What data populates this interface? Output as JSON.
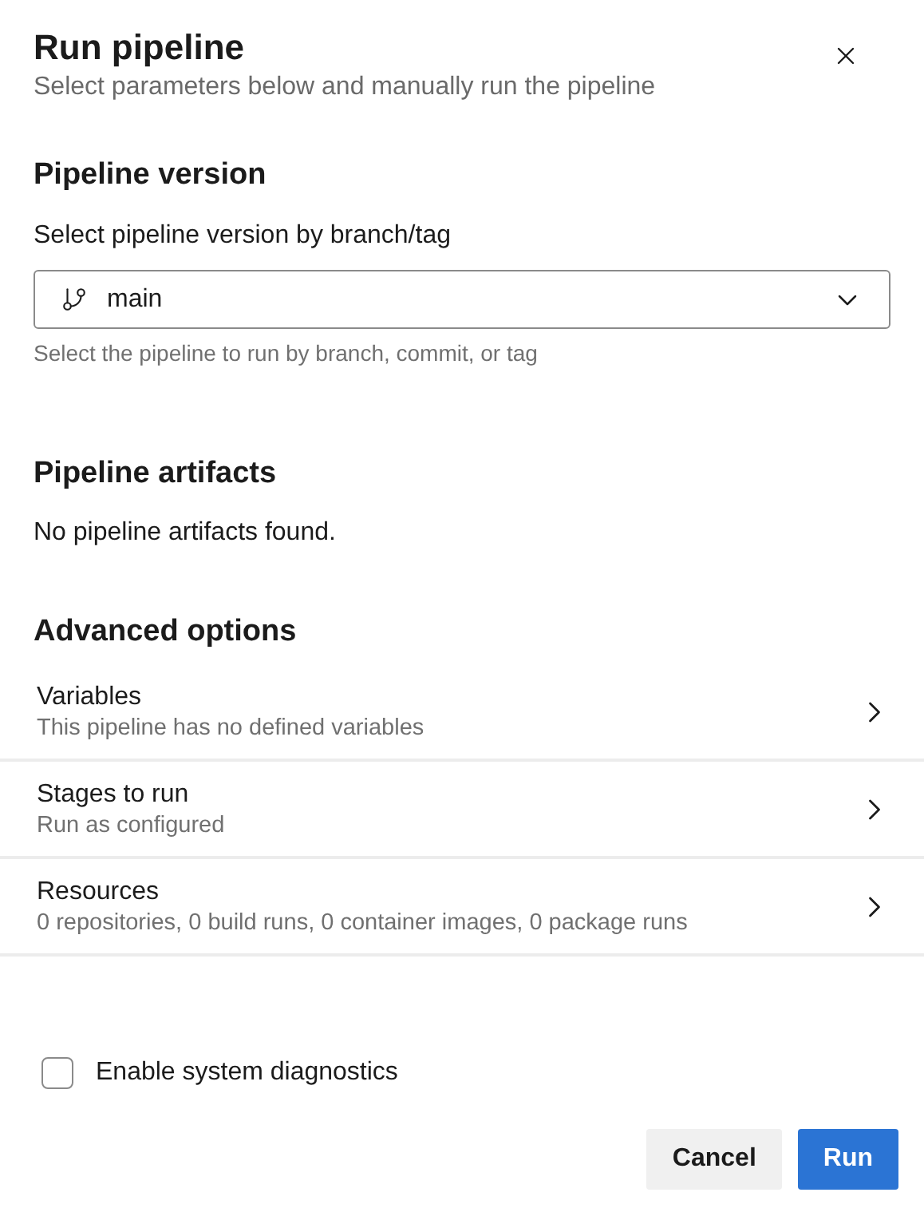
{
  "dialog": {
    "title": "Run pipeline",
    "subtitle": "Select parameters below and manually run the pipeline"
  },
  "version_section": {
    "heading": "Pipeline version",
    "field_label": "Select pipeline version by branch/tag",
    "value": "main",
    "help": "Select the pipeline to run by branch, commit, or tag"
  },
  "artifacts_section": {
    "heading": "Pipeline artifacts",
    "message": "No pipeline artifacts found."
  },
  "advanced_section": {
    "heading": "Advanced options",
    "items": [
      {
        "title": "Variables",
        "description": "This pipeline has no defined variables"
      },
      {
        "title": "Stages to run",
        "description": "Run as configured"
      },
      {
        "title": "Resources",
        "description": "0 repositories, 0 build runs, 0 container images, 0 package runs"
      }
    ]
  },
  "diagnostics": {
    "label": "Enable system diagnostics",
    "checked": false
  },
  "buttons": [
    {
      "label": "Cancel",
      "kind": "default"
    },
    {
      "label": "Run",
      "kind": "primary"
    }
  ]
}
